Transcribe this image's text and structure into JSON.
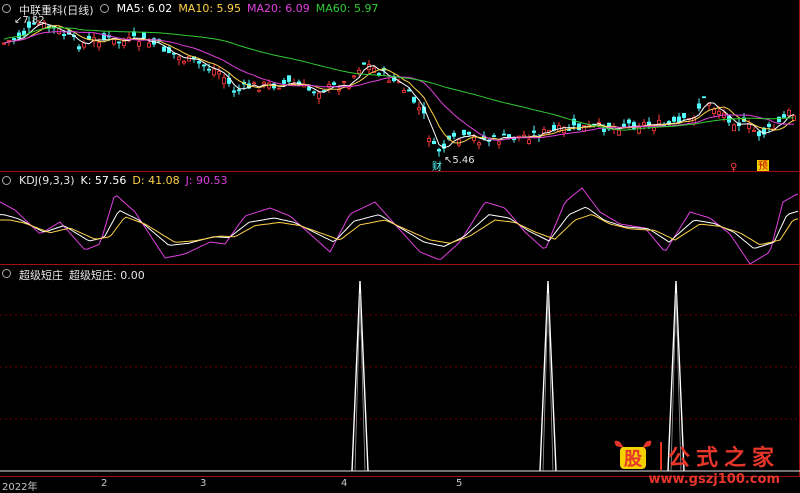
{
  "main_panel": {
    "title": "中联重科(日线)",
    "ma": [
      {
        "label": "MA5: 6.02",
        "color": "#ffffff"
      },
      {
        "label": "MA10: 5.95",
        "color": "#ffd24a"
      },
      {
        "label": "MA20: 6.09",
        "color": "#e040e0"
      },
      {
        "label": "MA60: 5.97",
        "color": "#33cc33"
      }
    ],
    "high_marker": "7.82",
    "low_marker": "5.46",
    "event_marks": {
      "cai": "财",
      "fu": "♀",
      "yu": "预"
    }
  },
  "kdj_panel": {
    "title": "KDJ(9,3,3)",
    "k_label": "K: 57.56",
    "d_label": "D: 41.08",
    "j_label": "J: 90.53"
  },
  "signal_panel": {
    "title": "超级短庄",
    "value_label": "超级短庄: 0.00"
  },
  "date_axis": [
    "2022年",
    "2",
    "3",
    "4",
    "5"
  ],
  "watermark": {
    "logo": "股",
    "name": "公式之家",
    "url": "www.gszj100.com"
  },
  "colors": {
    "up": "#ff3b3b",
    "down": "#54ffff",
    "ma5": "#ffffff",
    "ma10": "#ffd24a",
    "ma20": "#e040e0",
    "ma60": "#33cc33",
    "signal": "#ffffff",
    "grid": "#8b0000",
    "accent": "#e8352a"
  }
}
